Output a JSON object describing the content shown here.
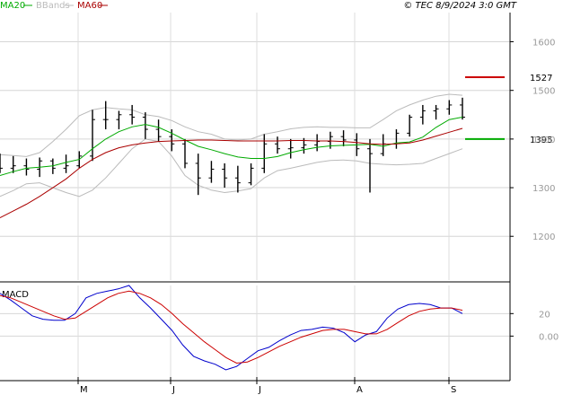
{
  "header": {
    "legend": [
      {
        "label": "MA20",
        "color": "#00aa00"
      },
      {
        "label": "BBands",
        "color": "#bbbbbb"
      },
      {
        "label": "MA60",
        "color": "#aa0000"
      }
    ],
    "source": "© TEC 8/9/2024 3:0 GMT"
  },
  "chart_data": [
    {
      "type": "line",
      "panel": "price",
      "y_ticks": [
        1200,
        1300,
        1400,
        1500,
        1600
      ],
      "y_tick_labels": [
        "1200",
        "1300",
        "1400",
        "1500",
        "1600"
      ],
      "ylim": [
        1110,
        1660
      ],
      "x_ticks": [
        "M",
        "J",
        "J",
        "A",
        "S"
      ],
      "grid": true,
      "annotations": [
        {
          "label": "1527",
          "value": 1527,
          "color": "#cc0000"
        },
        {
          "label": "1395",
          "value": 1400,
          "color": "#00aa00"
        }
      ],
      "series": [
        {
          "name": "MA20",
          "color": "#00aa00",
          "values": [
            1325,
            1333,
            1340,
            1342,
            1345,
            1352,
            1358,
            1380,
            1400,
            1415,
            1425,
            1430,
            1424,
            1412,
            1398,
            1385,
            1378,
            1370,
            1363,
            1360,
            1360,
            1364,
            1372,
            1378,
            1383,
            1386,
            1387,
            1388,
            1389,
            1385,
            1392,
            1394,
            1404,
            1424,
            1440,
            1445
          ]
        },
        {
          "name": "BBands upper",
          "color": "#bbbbbb",
          "values": [
            1368,
            1366,
            1364,
            1372,
            1395,
            1420,
            1448,
            1460,
            1465,
            1462,
            1460,
            1450,
            1446,
            1438,
            1425,
            1415,
            1410,
            1400,
            1398,
            1400,
            1410,
            1415,
            1421,
            1424,
            1425,
            1424,
            1424,
            1423,
            1423,
            1440,
            1458,
            1470,
            1480,
            1488,
            1492,
            1490
          ]
        },
        {
          "name": "BBands lower",
          "color": "#bbbbbb",
          "values": [
            1282,
            1294,
            1308,
            1310,
            1300,
            1290,
            1282,
            1295,
            1320,
            1350,
            1380,
            1400,
            1395,
            1365,
            1325,
            1305,
            1295,
            1290,
            1293,
            1298,
            1320,
            1335,
            1340,
            1346,
            1352,
            1356,
            1357,
            1355,
            1350,
            1348,
            1347,
            1348,
            1350,
            1360,
            1370,
            1380
          ]
        },
        {
          "name": "MA60",
          "color": "#aa0000",
          "values": [
            1238,
            1252,
            1266,
            1282,
            1300,
            1318,
            1340,
            1358,
            1372,
            1382,
            1388,
            1392,
            1395,
            1396,
            1397,
            1398,
            1398,
            1397,
            1396,
            1396,
            1396,
            1396,
            1397,
            1397,
            1396,
            1396,
            1395,
            1393,
            1390,
            1389,
            1390,
            1392,
            1398,
            1406,
            1414,
            1422
          ]
        }
      ],
      "candles": [
        [
          1345,
          1370,
          1330,
          1340
        ],
        [
          1340,
          1365,
          1330,
          1345
        ],
        [
          1345,
          1360,
          1325,
          1338
        ],
        [
          1338,
          1362,
          1322,
          1355
        ],
        [
          1355,
          1360,
          1328,
          1340
        ],
        [
          1340,
          1368,
          1330,
          1345
        ],
        [
          1345,
          1375,
          1340,
          1365
        ],
        [
          1365,
          1460,
          1355,
          1440
        ],
        [
          1440,
          1478,
          1420,
          1440
        ],
        [
          1440,
          1458,
          1420,
          1450
        ],
        [
          1450,
          1470,
          1430,
          1445
        ],
        [
          1445,
          1455,
          1400,
          1420
        ],
        [
          1420,
          1440,
          1395,
          1405
        ],
        [
          1405,
          1420,
          1375,
          1390
        ],
        [
          1390,
          1400,
          1340,
          1350
        ],
        [
          1350,
          1370,
          1285,
          1320
        ],
        [
          1320,
          1355,
          1310,
          1338
        ],
        [
          1338,
          1350,
          1300,
          1320
        ],
        [
          1320,
          1345,
          1290,
          1310
        ],
        [
          1310,
          1350,
          1305,
          1340
        ],
        [
          1340,
          1410,
          1330,
          1390
        ],
        [
          1390,
          1405,
          1370,
          1380
        ],
        [
          1380,
          1400,
          1360,
          1382
        ],
        [
          1382,
          1402,
          1370,
          1388
        ],
        [
          1388,
          1410,
          1375,
          1395
        ],
        [
          1395,
          1415,
          1380,
          1405
        ],
        [
          1405,
          1418,
          1385,
          1398
        ],
        [
          1398,
          1412,
          1365,
          1380
        ],
        [
          1380,
          1400,
          1290,
          1370
        ],
        [
          1370,
          1410,
          1365,
          1390
        ],
        [
          1390,
          1420,
          1380,
          1412
        ],
        [
          1412,
          1450,
          1405,
          1445
        ],
        [
          1445,
          1470,
          1430,
          1458
        ],
        [
          1458,
          1470,
          1440,
          1462
        ],
        [
          1462,
          1480,
          1450,
          1470
        ],
        [
          1470,
          1485,
          1440,
          1445
        ]
      ]
    },
    {
      "type": "line",
      "panel": "macd",
      "title": "MACD",
      "y_ticks": [
        0,
        20
      ],
      "y_tick_labels": [
        "0.00",
        "20"
      ],
      "ylim": [
        -38,
        45
      ],
      "x_ticks": [
        "M",
        "J",
        "J",
        "A",
        "S"
      ],
      "grid": true,
      "series": [
        {
          "name": "MACD",
          "color": "#0000cc",
          "values": [
            38,
            32,
            25,
            18,
            15,
            14,
            14,
            20,
            34,
            38,
            40,
            42,
            45,
            34,
            25,
            15,
            5,
            -8,
            -18,
            -22,
            -25,
            -30,
            -27,
            -20,
            -13,
            -10,
            -4,
            1,
            5,
            6,
            8,
            7,
            3,
            -5,
            1,
            4,
            16,
            24,
            28,
            29,
            28,
            25,
            25,
            20
          ]
        },
        {
          "name": "Signal",
          "color": "#cc0000",
          "values": [
            36,
            34,
            30,
            26,
            22,
            18,
            15,
            16,
            22,
            28,
            34,
            38,
            40,
            38,
            34,
            28,
            20,
            11,
            3,
            -5,
            -12,
            -19,
            -24,
            -23,
            -19,
            -14,
            -9,
            -5,
            -1,
            2,
            5,
            6,
            6,
            4,
            2,
            2,
            6,
            12,
            18,
            22,
            24,
            25,
            25,
            23
          ]
        }
      ]
    }
  ]
}
